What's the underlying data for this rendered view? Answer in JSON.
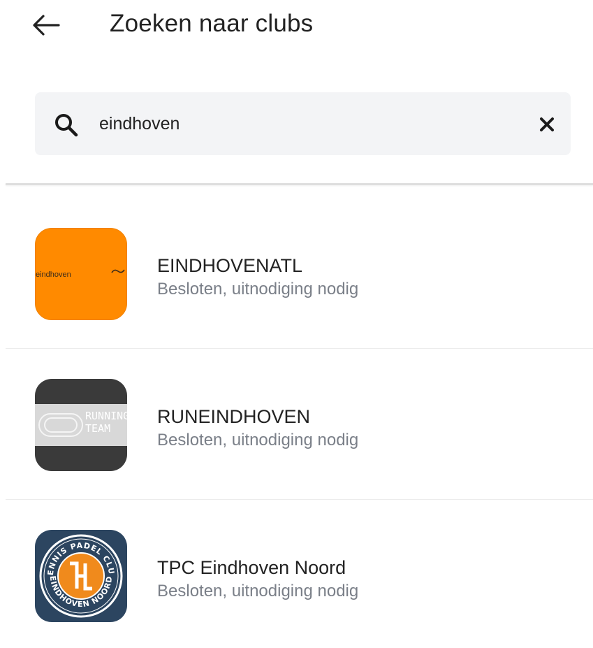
{
  "header": {
    "title": "Zoeken naar clubs"
  },
  "search": {
    "value": "eindhoven"
  },
  "results": [
    {
      "name": "EINDHOVENATL",
      "status": "Besloten, uitnodiging nodig",
      "logo_text": "eindhoven"
    },
    {
      "name": "RUNEINDHOVEN",
      "status": "Besloten, uitnodiging nodig",
      "logo_text_1": "RUNNING",
      "logo_text_2": "TEAM"
    },
    {
      "name": "TPC Eindhoven Noord",
      "status": "Besloten, uitnodiging nodig",
      "logo_text_top": "TENNIS PADEL CLUB",
      "logo_text_bottom": "EINDHOVEN NOORD"
    }
  ],
  "colors": {
    "search_bg": "#f3f4f6",
    "status_text": "#7a7f88",
    "logo1_bg": "#ff8a00",
    "logo2_bg": "#3a3a3a",
    "logo3_bg": "#2c4560",
    "logo3_accent": "#f08a1c"
  }
}
